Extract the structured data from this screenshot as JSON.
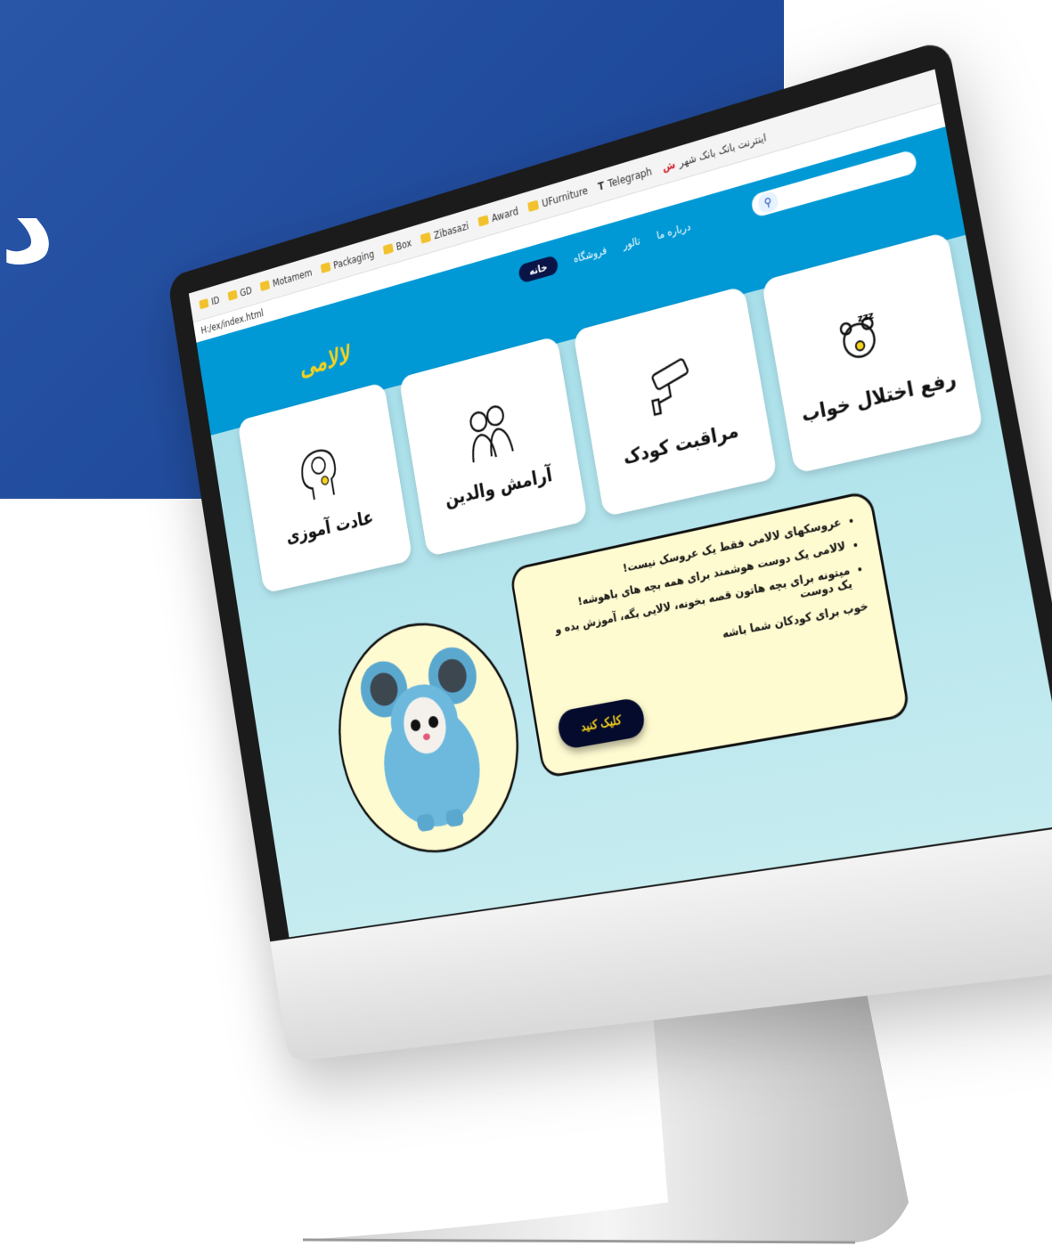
{
  "background": {
    "letter": "د"
  },
  "browser": {
    "url": "H:/ex/index.html",
    "bookmarks": [
      "ID",
      "GD",
      "Motamem",
      "Packaging",
      "Box",
      "Zibasazi",
      "Award",
      "UFurniture"
    ],
    "telegraph": "Telegraph",
    "bank_link": "اینترنت بانک بانک شهر"
  },
  "site": {
    "logo": "لالامی",
    "nav": [
      "خانه",
      "فروشگاه",
      "تالور",
      "درباره ما"
    ],
    "features": [
      {
        "label": "رفع اختلال خواب",
        "icon": "teddy-sleep-icon"
      },
      {
        "label": "مراقبت کودک",
        "icon": "camera-icon"
      },
      {
        "label": "آرامش والدین",
        "icon": "parents-icon"
      },
      {
        "label": "عادت آموزی",
        "icon": "brain-icon"
      }
    ],
    "bullets": [
      "عروسکهای لالامی فقط یک عروسک نیست!",
      "لالامی یک دوست هوشمند برای همه بچه های باهوشه!",
      "میتونه برای بچه هاتون قصه بخونه، لالایی بگه، آموزش بده و یک دوست"
    ],
    "paragraph_end": "خوب برای کودکان شما باشه",
    "cta_label": "کلیک کنید"
  },
  "colors": {
    "header": "#0099d6",
    "panel": "#2a56a8",
    "cta_bg": "#050b2c",
    "cta_text": "#f6d21b",
    "bubble": "#fffbd1"
  }
}
